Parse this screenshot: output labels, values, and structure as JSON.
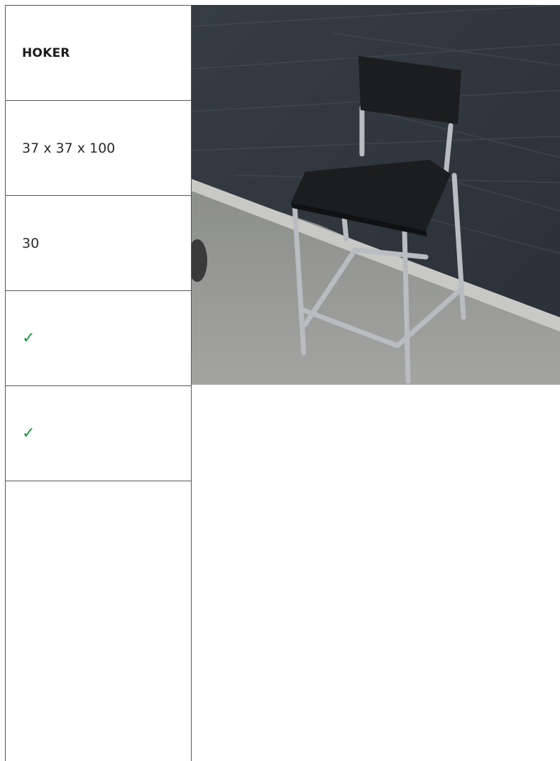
{
  "product": {
    "name": "HOKER",
    "dimensions": "37 x 37 x 100",
    "quantity": "30",
    "check_1": "✓",
    "check_2": "✓"
  },
  "colors": {
    "check": "#1a9a3a",
    "border": "#555555"
  },
  "image": {
    "subject": "bar-stool-photo"
  }
}
